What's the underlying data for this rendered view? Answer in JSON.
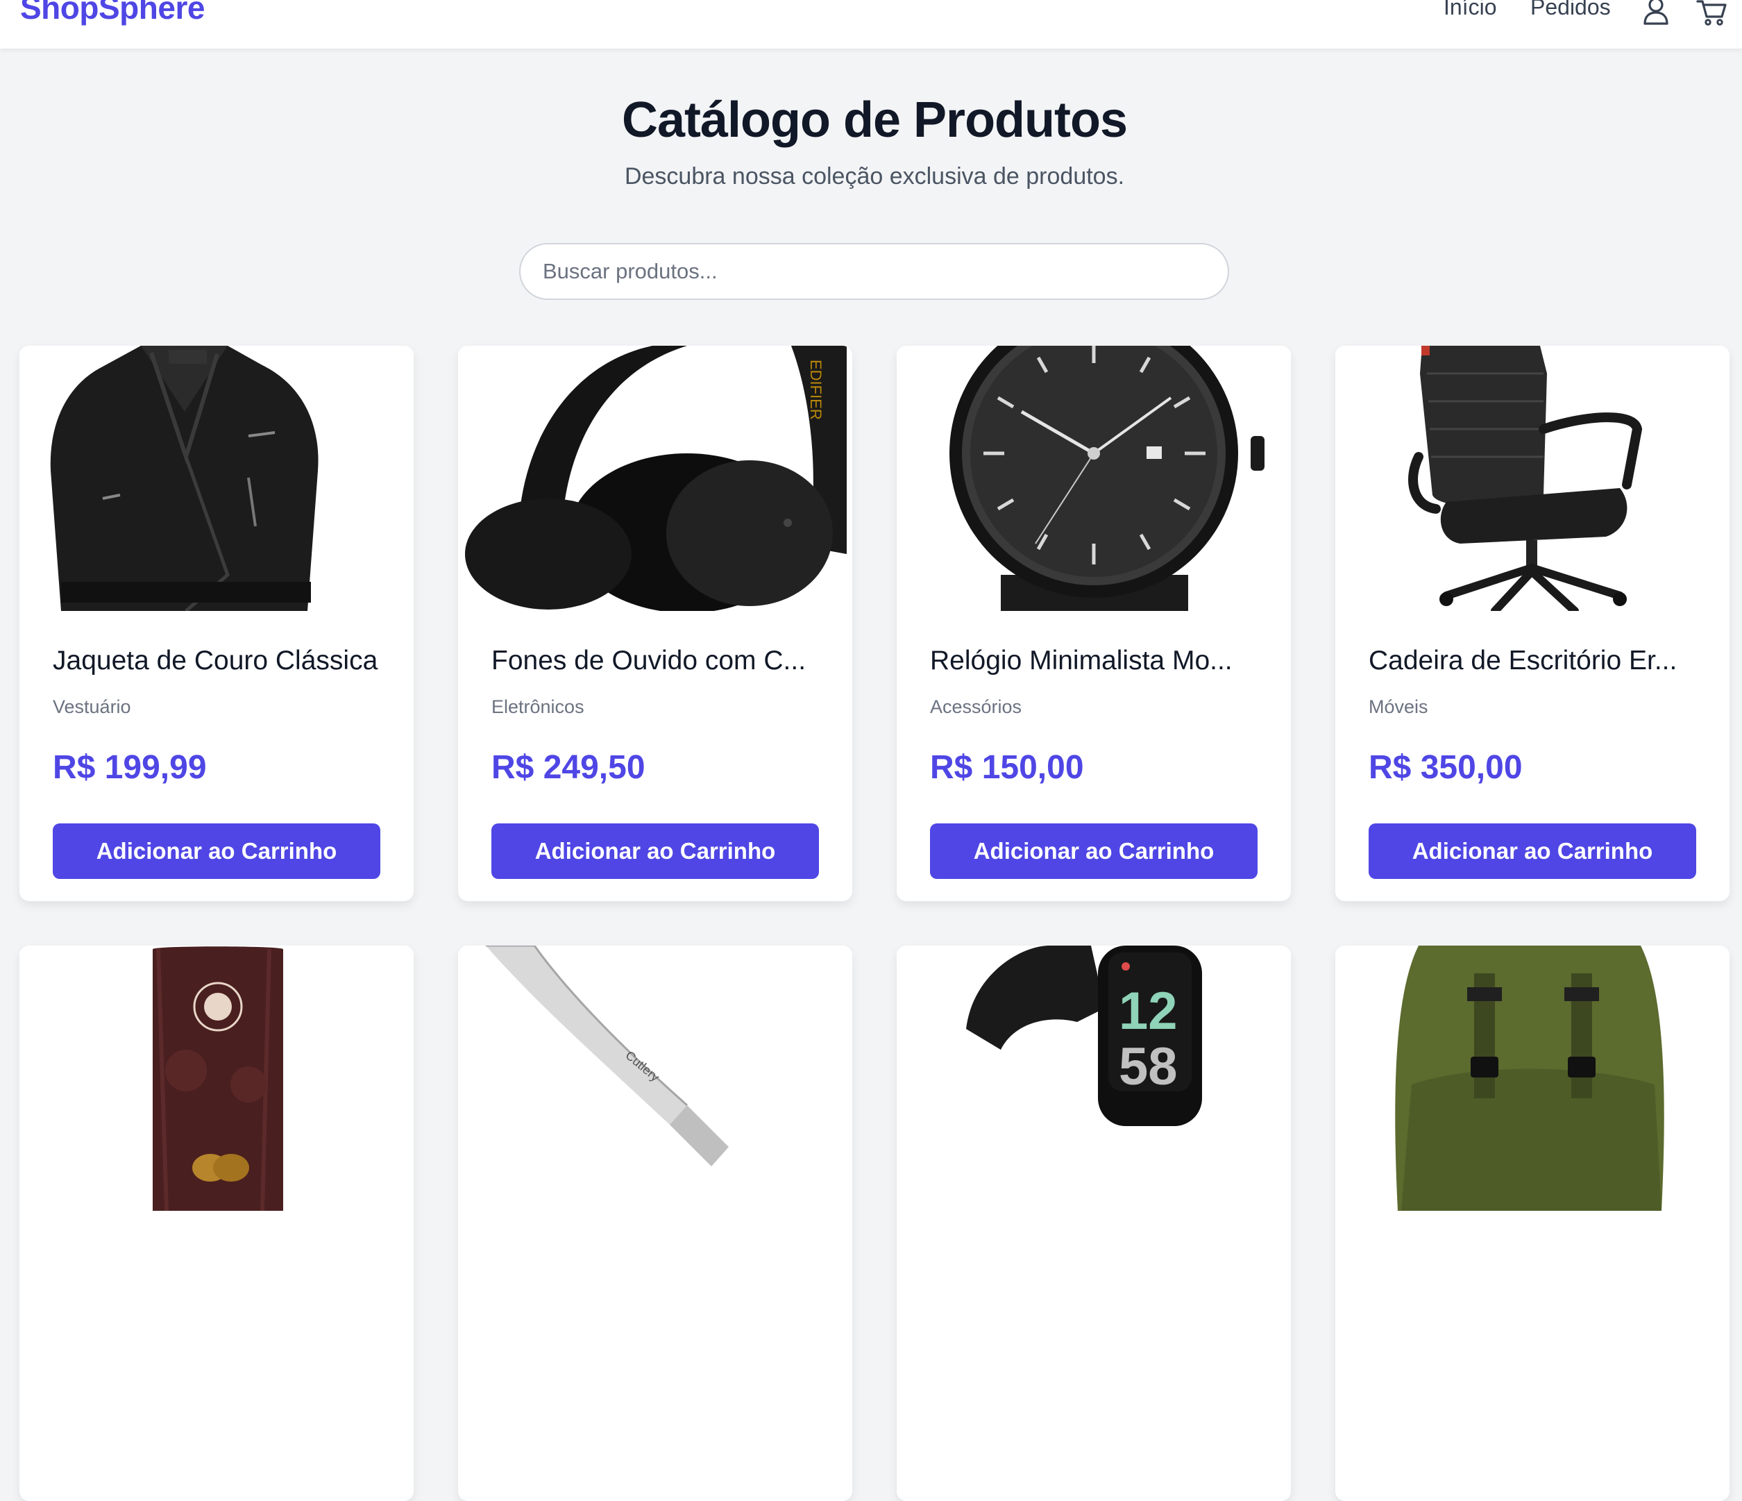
{
  "header": {
    "logo": "ShopSphere",
    "nav": {
      "inicio": "Início",
      "pedidos": "Pedidos"
    },
    "icons": {
      "user": "user-icon",
      "cart": "cart-icon"
    }
  },
  "hero": {
    "title": "Catálogo de Produtos",
    "subtitle": "Descubra nossa coleção exclusiva de produtos."
  },
  "search": {
    "placeholder": "Buscar produtos...",
    "value": ""
  },
  "colors": {
    "accent": "#4f46e5",
    "background": "#f3f4f6",
    "card": "#ffffff",
    "title": "#111827",
    "muted": "#6b7280"
  },
  "products": [
    {
      "name": "Jaqueta de Couro Clássica",
      "category": "Vestuário",
      "price": "R$ 199,99",
      "button": "Adicionar ao Carrinho",
      "image": "leather-jacket-image"
    },
    {
      "name": "Fones de Ouvido com C...",
      "category": "Eletrônicos",
      "price": "R$ 249,50",
      "button": "Adicionar ao Carrinho",
      "image": "headphones-image"
    },
    {
      "name": "Relógio Minimalista Mo...",
      "category": "Acessórios",
      "price": "R$ 150,00",
      "button": "Adicionar ao Carrinho",
      "image": "watch-image"
    },
    {
      "name": "Cadeira de Escritório Er...",
      "category": "Móveis",
      "price": "R$ 350,00",
      "button": "Adicionar ao Carrinho",
      "image": "office-chair-image"
    },
    {
      "image": "coffee-bag-image"
    },
    {
      "image": "kitchen-knife-image"
    },
    {
      "image": "fitness-band-image"
    },
    {
      "image": "backpack-image"
    }
  ],
  "fitness_band_display": {
    "hours": "12",
    "minutes": "58"
  }
}
